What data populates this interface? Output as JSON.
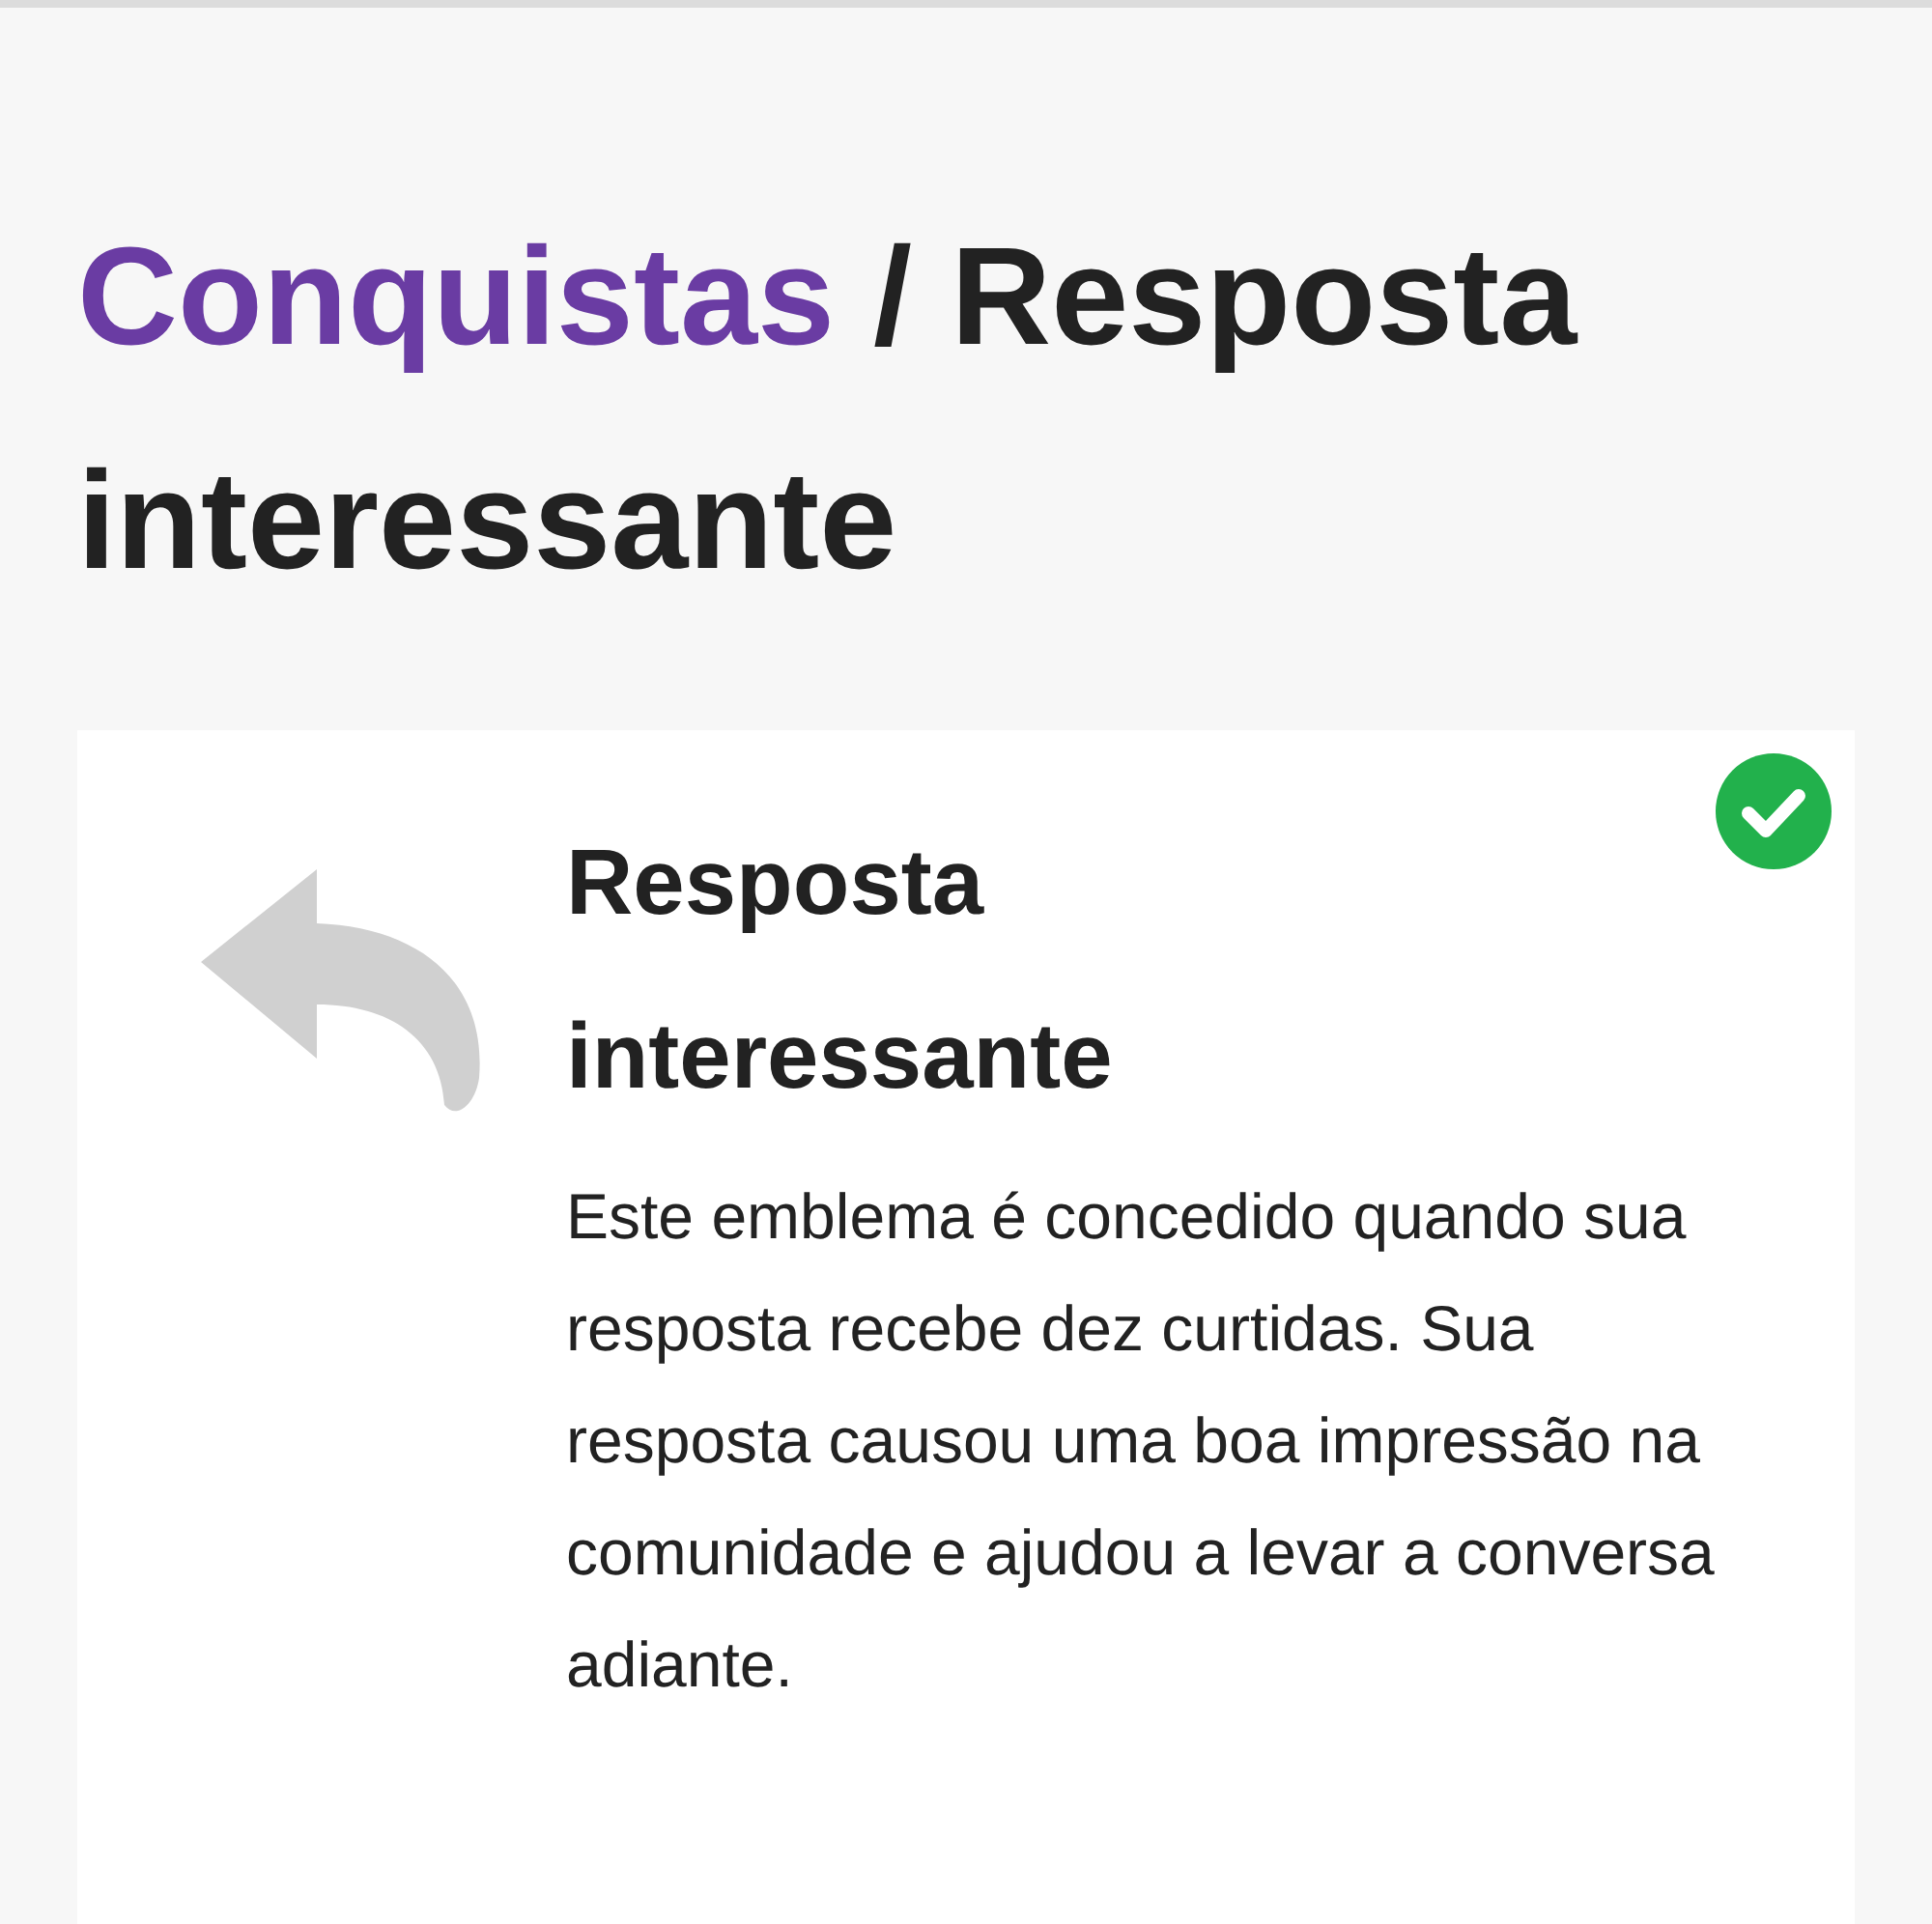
{
  "breadcrumb": {
    "link": "Conquistas",
    "separator": "/",
    "current": "Resposta interessante"
  },
  "badge": {
    "title": "Resposta interessante",
    "description": "Este emblema é concedido quando sua resposta recebe dez curtidas. Sua resposta causou uma boa impressão na comunidade e ajudou a levar a conversa adiante.",
    "earned": true
  }
}
